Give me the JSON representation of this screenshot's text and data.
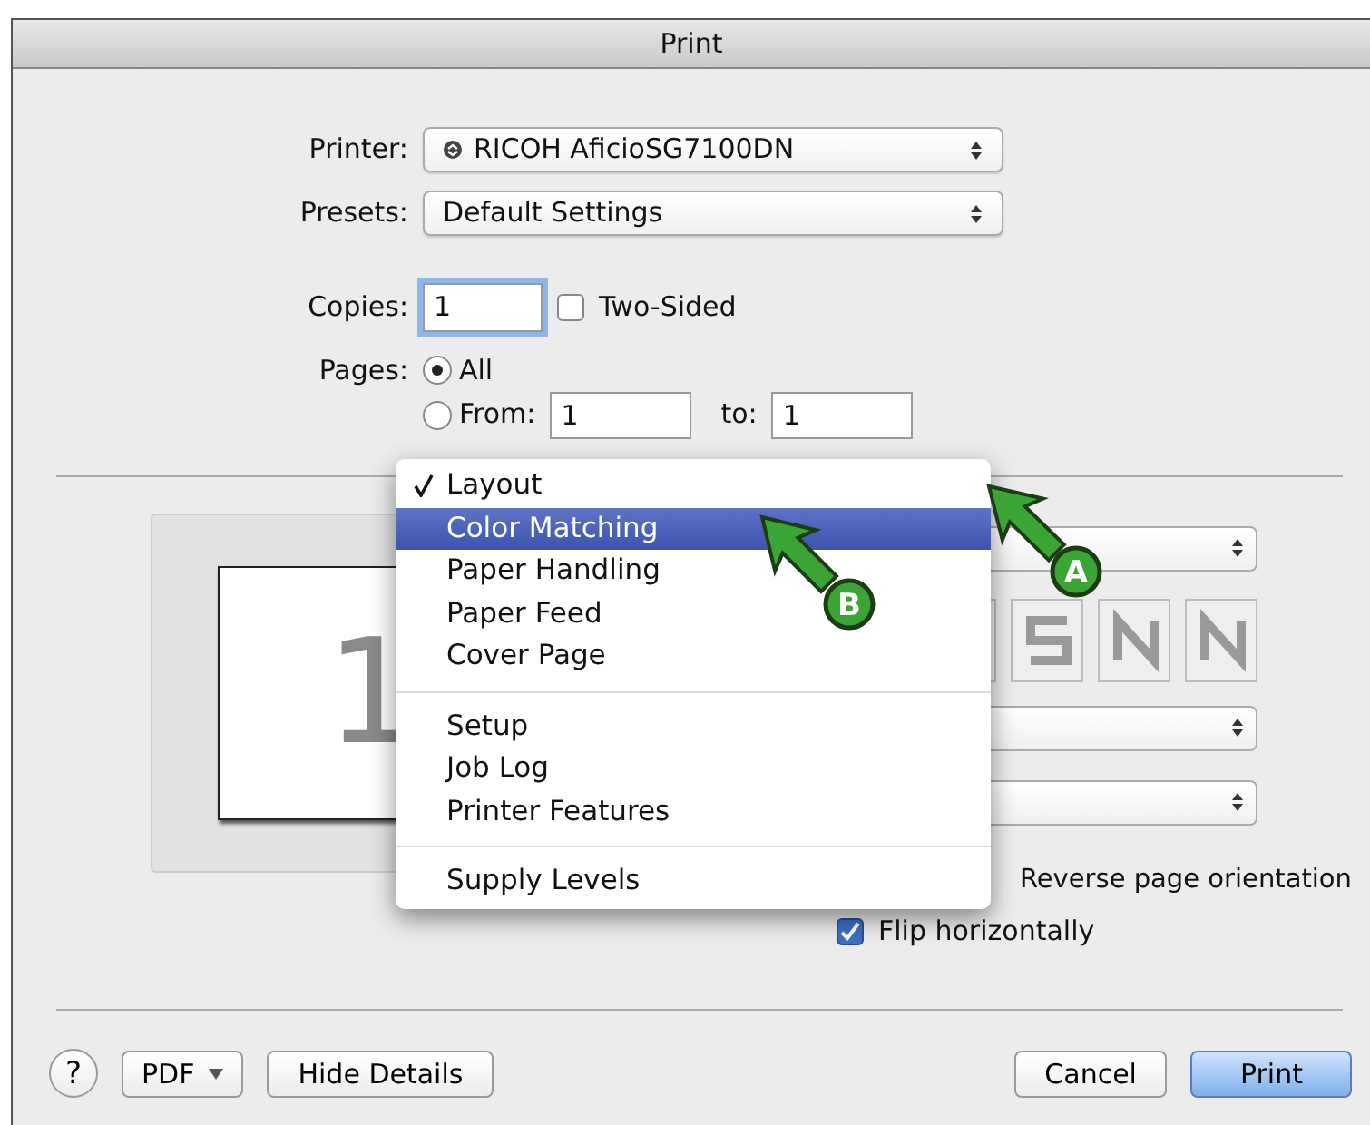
{
  "window": {
    "title": "Print"
  },
  "printer": {
    "label": "Printer:",
    "value": "RICOH AficioSG7100DN"
  },
  "presets": {
    "label": "Presets:",
    "value": "Default Settings"
  },
  "copies": {
    "label": "Copies:",
    "value": "1"
  },
  "two_sided": {
    "label": "Two-Sided",
    "checked": false
  },
  "pages": {
    "label": "Pages:",
    "options": [
      {
        "label": "All",
        "selected": true
      },
      {
        "label": "From:",
        "selected": false
      }
    ],
    "from": "1",
    "to_label": "to:",
    "to": "1"
  },
  "panel_menu": {
    "groups": [
      [
        {
          "label": "Layout",
          "checked": true,
          "selected": false
        },
        {
          "label": "Color Matching",
          "checked": false,
          "selected": true
        },
        {
          "label": "Paper Handling",
          "checked": false,
          "selected": false
        },
        {
          "label": "Paper Feed",
          "checked": false,
          "selected": false
        },
        {
          "label": "Cover Page",
          "checked": false,
          "selected": false
        }
      ],
      [
        {
          "label": "Setup",
          "checked": false,
          "selected": false
        },
        {
          "label": "Job Log",
          "checked": false,
          "selected": false
        },
        {
          "label": "Printer Features",
          "checked": false,
          "selected": false
        }
      ],
      [
        {
          "label": "Supply Levels",
          "checked": false,
          "selected": false
        }
      ]
    ]
  },
  "preview": {
    "page_number": "1"
  },
  "layout": {
    "reverse_label": "Reverse page orientation",
    "flip": {
      "label": "Flip horizontally",
      "checked": true
    }
  },
  "annotations": [
    {
      "letter": "A"
    },
    {
      "letter": "B"
    }
  ],
  "buttons": [
    {
      "kind": "help",
      "label": "?"
    },
    {
      "kind": "menu",
      "label": "PDF"
    },
    {
      "kind": "plain",
      "label": "Hide Details"
    },
    {
      "kind": "spacer"
    },
    {
      "kind": "plain",
      "label": "Cancel"
    },
    {
      "kind": "default",
      "label": "Print"
    }
  ]
}
